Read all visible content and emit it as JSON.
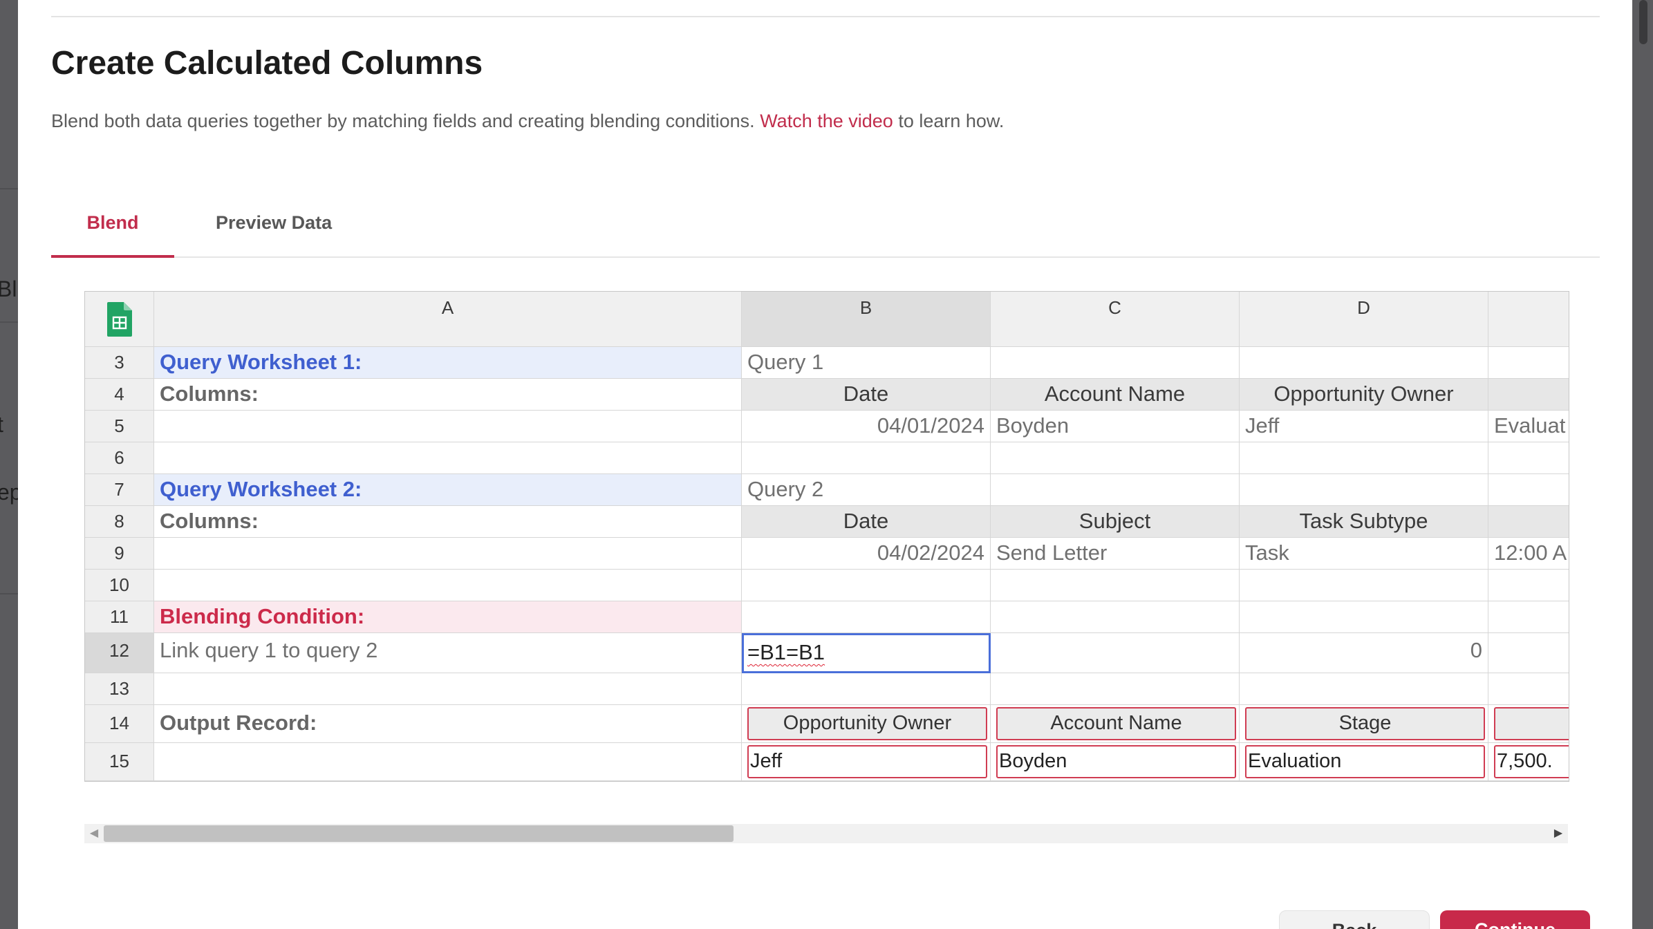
{
  "dialog": {
    "title": "Create Calculated Columns",
    "description": "Blend both data queries together by matching fields and creating blending conditions.",
    "link_text": "Watch the video",
    "description_suffix": "to learn how."
  },
  "tabs": [
    {
      "label": "Blend",
      "active": true
    },
    {
      "label": "Preview Data",
      "active": false
    }
  ],
  "sheet": {
    "column_letters": [
      "A",
      "B",
      "C",
      "D"
    ],
    "rows": {
      "r3": {
        "num": "3",
        "a": "Query Worksheet 1:",
        "b": "Query 1"
      },
      "r4": {
        "num": "4",
        "a": "Columns:",
        "b": "Date",
        "c": "Account Name",
        "d": "Opportunity Owner"
      },
      "r5": {
        "num": "5",
        "b": "04/01/2024",
        "c": "Boyden",
        "d": "Jeff",
        "e": "Evaluat"
      },
      "r6": {
        "num": "6"
      },
      "r7": {
        "num": "7",
        "a": "Query Worksheet 2:",
        "b": "Query 2"
      },
      "r8": {
        "num": "8",
        "a": "Columns:",
        "b": "Date",
        "c": "Subject",
        "d": "Task Subtype"
      },
      "r9": {
        "num": "9",
        "b": "04/02/2024",
        "c": "Send Letter",
        "d": "Task",
        "e": "12:00 A"
      },
      "r10": {
        "num": "10"
      },
      "r11": {
        "num": "11",
        "a": "Blending Condition:"
      },
      "r12": {
        "num": "12",
        "a": "Link query 1 to query 2",
        "b": "=B1=B1",
        "d": "0"
      },
      "r13": {
        "num": "13"
      },
      "r14": {
        "num": "14",
        "a": "Output Record:",
        "b": "Opportunity Owner",
        "c": "Account Name",
        "d": "Stage",
        "e": ""
      },
      "r15": {
        "num": "15",
        "b": "Jeff",
        "c": "Boyden",
        "d": "Evaluation",
        "e": "7,500."
      }
    }
  },
  "footer": {
    "back_label": "Back",
    "continue_label": "Continue"
  },
  "background": {
    "fragments": [
      "Bl",
      "t",
      "ep"
    ]
  },
  "colors": {
    "accent": "#c12d4c",
    "query_label": "#3f5fcf",
    "selection": "#4a6fd9"
  }
}
